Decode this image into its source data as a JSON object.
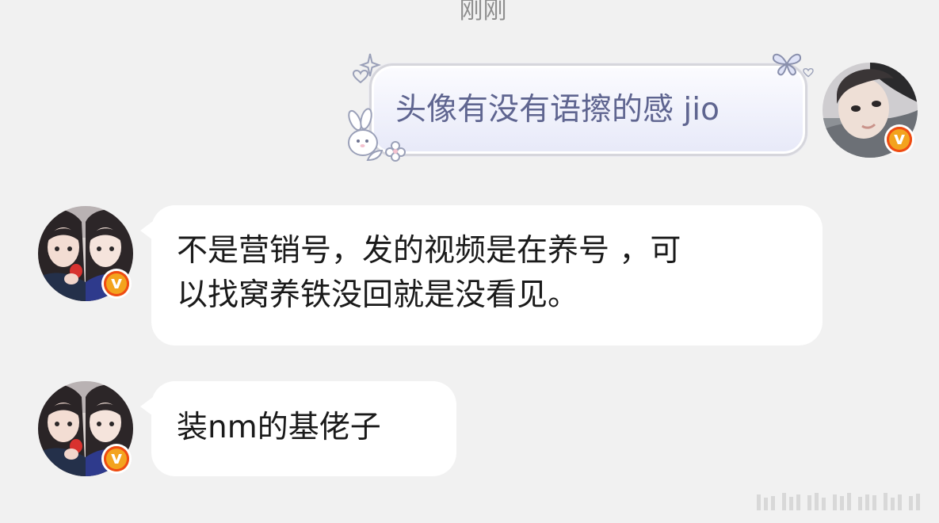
{
  "timestamp": "刚刚",
  "messages": [
    {
      "direction": "outgoing",
      "sender": "self",
      "text": "头像有没有语擦的感 jio",
      "bubble_style": "decorated-lilac",
      "verified": true
    },
    {
      "direction": "incoming",
      "sender": "other",
      "lines": [
        "不是营销号，发的视频是在养号 ，可",
        "以找窝养铁没回就是没看见。"
      ],
      "verified": true
    },
    {
      "direction": "incoming",
      "sender": "other",
      "text": "装nm的基佬子",
      "verified": true
    }
  ],
  "badges": {
    "verified_glyph": "v"
  },
  "icons": {
    "verified": "verified-v-icon",
    "bubble_decoration": [
      "sparkle-icon",
      "heart-icon",
      "butterfly-icon",
      "bunny-icon",
      "flower-icon"
    ]
  },
  "colors": {
    "background": "#f1f1f1",
    "incoming_bubble": "#ffffff",
    "outgoing_text": "#5f6590",
    "incoming_text": "#1a1a1a",
    "timestamp": "#8e8e8e",
    "verified_badge": "#f3a31e",
    "verified_ring": "#ef4b14"
  }
}
